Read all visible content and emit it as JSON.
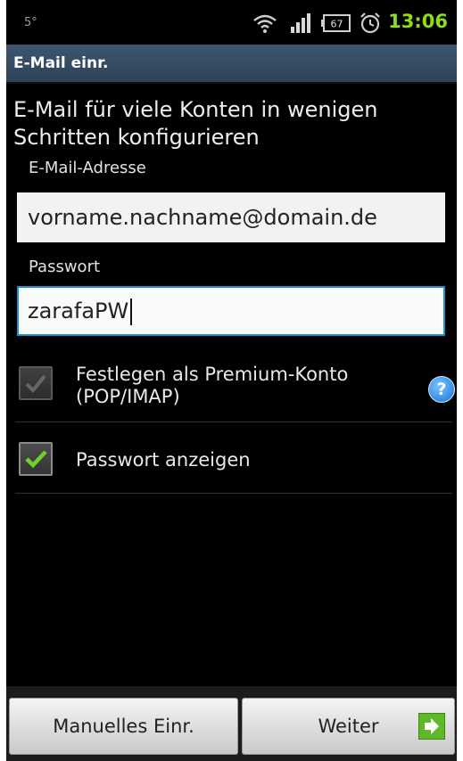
{
  "statusbar": {
    "left_text": "5°",
    "battery_level": "67",
    "time": "13:06",
    "time_color": "#8fdc1a"
  },
  "titlebar": {
    "title": "E-Mail einr."
  },
  "heading": "E-Mail für viele Konten in wenigen Schritten konfigurieren",
  "form": {
    "email_label": "E-Mail-Adresse",
    "email_value": "vorname.nachname@domain.de",
    "password_label": "Passwort",
    "password_value": "zarafaPW"
  },
  "options": {
    "premium_label_line1": "Festlegen als Premium-Konto",
    "premium_label_line2": "(POP/IMAP)",
    "premium_checked": false,
    "help_icon_text": "?",
    "show_password_label": "Passwort anzeigen",
    "show_password_checked": true
  },
  "buttons": {
    "manual_label": "Manuelles Einr.",
    "next_label": "Weiter"
  },
  "colors": {
    "accent_blue": "#1b8fcf",
    "check_green": "#6fd02a"
  }
}
